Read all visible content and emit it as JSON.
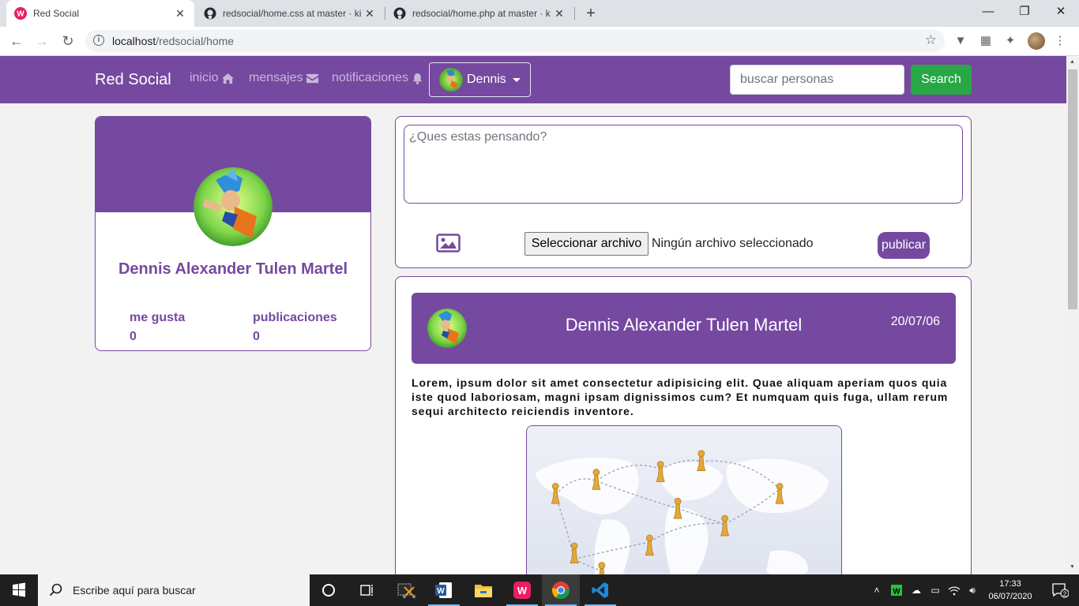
{
  "browser": {
    "tabs": [
      {
        "title": "Red Social",
        "active": true
      },
      {
        "title": "redsocial/home.css at master · ki",
        "active": false
      },
      {
        "title": "redsocial/home.php at master · k",
        "active": false
      }
    ],
    "address": {
      "host": "localhost",
      "path": "/redsocial/home"
    }
  },
  "site": {
    "brand": "Red Social",
    "nav": {
      "inicio": "inicio",
      "mensajes": "mensajes",
      "notificaciones": "notificaciones"
    },
    "user": "Dennis",
    "search_placeholder": "buscar personas",
    "search_button": "Search",
    "accent_color": "#7549a0",
    "search_button_color": "#28a745"
  },
  "profile": {
    "name": "Dennis Alexander Tulen Martel",
    "likes_label": "me gusta",
    "likes_value": "0",
    "posts_label": "publicaciones",
    "posts_value": "0"
  },
  "composer": {
    "placeholder": "¿Ques estas pensando?",
    "file_button": "Seleccionar archivo",
    "file_status": "Ningún archivo seleccionado",
    "publish_button": "publicar"
  },
  "post": {
    "author": "Dennis Alexander Tulen Martel",
    "date": "20/07/06",
    "body": "Lorem, ipsum dolor sit amet consectetur adipisicing elit. Quae aliquam aperiam quos quia iste quod laboriosam, magni ipsam dignissimos cum? Et numquam quis fuga, ullam rerum sequi architecto reiciendis inventore."
  },
  "taskbar": {
    "search_text": "Escribe aquí para buscar",
    "time": "17:33",
    "date": "06/07/2020",
    "notification_count": "2"
  }
}
